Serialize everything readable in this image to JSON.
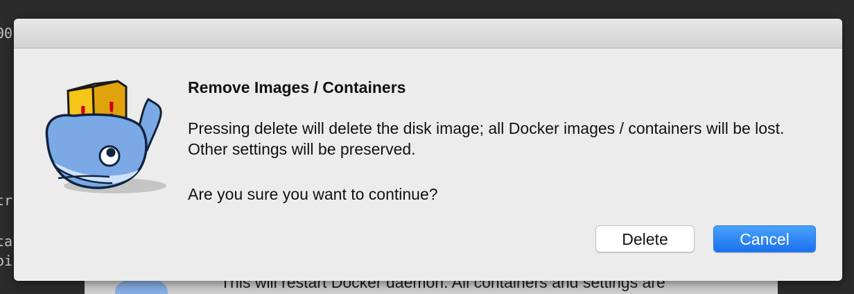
{
  "background": {
    "fragments": [
      "00",
      "tr",
      "ta",
      "oi"
    ],
    "panel_text": "This will restart Docker daemon. All containers and settings are"
  },
  "dialog": {
    "title": "Remove Images / Containers",
    "message": "Pressing delete will delete the disk image; all Docker images / containers will be lost. Other settings will be preserved.",
    "question": "Are you sure you want to continue?",
    "icon": "docker-whale-warning-icon",
    "buttons": {
      "delete_label": "Delete",
      "cancel_label": "Cancel"
    },
    "colors": {
      "accent": "#1a72ee",
      "sheet_background": "#ececec"
    }
  }
}
